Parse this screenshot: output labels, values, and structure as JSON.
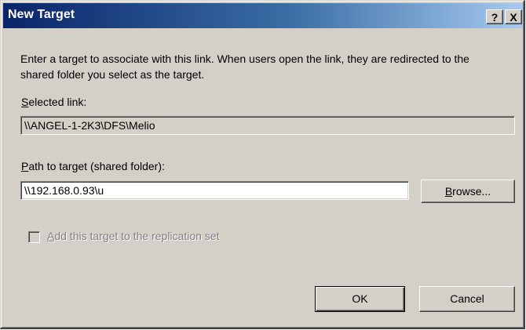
{
  "window": {
    "title": "New Target",
    "help_label": "?",
    "close_label": "X"
  },
  "description": "Enter a target to associate with this link. When users open the link, they are redirected to the shared folder you select as the target.",
  "selected_link": {
    "label_key": "S",
    "label_rest": "elected link:",
    "value": "\\\\ANGEL-1-2K3\\DFS\\Melio"
  },
  "path_to_target": {
    "label_key": "P",
    "label_rest": "ath to target (shared folder):",
    "value": "\\\\192.168.0.93\\u"
  },
  "browse_button": {
    "label_key": "B",
    "label_rest": "rowse..."
  },
  "replication_checkbox": {
    "label_key": "A",
    "label_rest": "dd this target to the replication set",
    "checked": false,
    "enabled": false
  },
  "buttons": {
    "ok": "OK",
    "cancel": "Cancel"
  }
}
